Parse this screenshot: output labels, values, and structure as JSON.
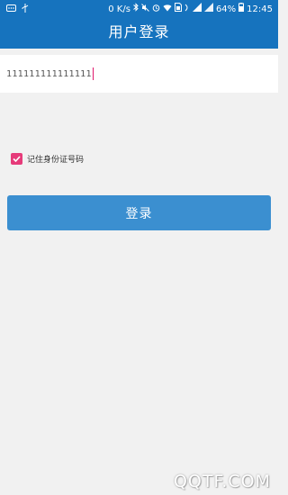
{
  "status_bar": {
    "left_icons": [
      "message-icon",
      "usb-icon"
    ],
    "network_speed": "0 K/s",
    "battery_percent": "64%",
    "time": "12:45"
  },
  "header": {
    "title": "用户登录"
  },
  "form": {
    "id_input_value": "111111111111111",
    "remember_label": "记住身份证号码",
    "remember_checked": true,
    "login_label": "登录"
  },
  "watermark": "QQTF.COM",
  "colors": {
    "header_bg": "#1673be",
    "button_bg": "#3b8fd0",
    "checkbox": "#e63b7a",
    "page_bg": "#f1f1f1"
  }
}
